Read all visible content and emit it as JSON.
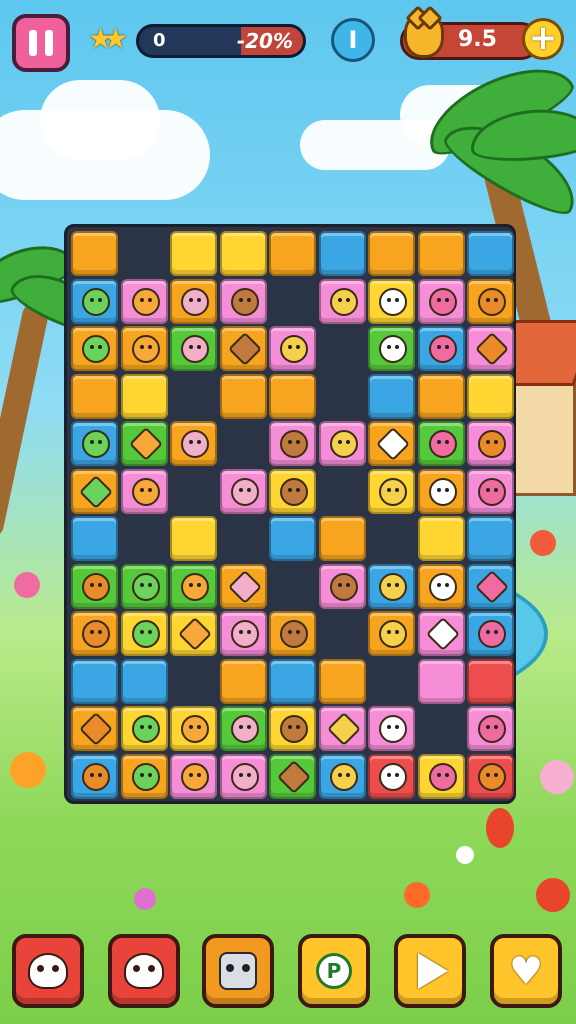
{
  "hud": {
    "progress_left": "0",
    "progress_right": "-20%",
    "progress_fill_fraction": 0.38,
    "info_label": "I",
    "coins": "9.5",
    "plus_label": "+",
    "stars_glyph": "★★"
  },
  "board": {
    "tiles": [
      [
        "orange",
        "face-green"
      ],
      [
        "blue",
        ""
      ]
    ]
  },
  "toolbar": {
    "items": [
      {
        "icon": "skull-icon"
      },
      {
        "icon": "skull-icon"
      },
      {
        "icon": "robot-icon"
      },
      {
        "icon": "pin-icon",
        "label": "P"
      },
      {
        "icon": "play-icon"
      },
      {
        "icon": "heart-icon"
      }
    ]
  },
  "colors": {
    "accent_pink": "#f0609b",
    "coin_panel": "#c54636",
    "board_frame": "#2b3346"
  }
}
